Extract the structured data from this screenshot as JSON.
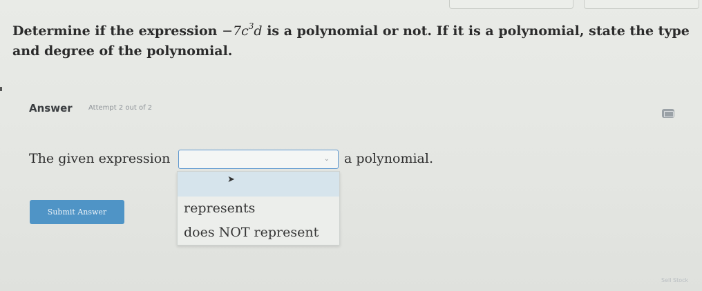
{
  "question": {
    "text_before": "Determine if the expression ",
    "expr_sign": "−",
    "expr_coef": "7",
    "expr_var1": "c",
    "expr_exp": "3",
    "expr_var2": "d",
    "text_after": " is a polynomial or not. If it is a polynomial, state the type and degree of the polynomial."
  },
  "answer": {
    "label": "Answer",
    "attempt": "Attempt 2 out of 2"
  },
  "sentence": {
    "before": "The given expression",
    "after": "a polynomial."
  },
  "select": {
    "value": "",
    "options": [
      "",
      "represents",
      "does NOT represent"
    ]
  },
  "submit_label": "Submit Answer",
  "corner_text": "Sell Stock",
  "icons": {
    "keyboard": "keyboard-icon",
    "chevron": "chevron-down-icon",
    "cursor": "mouse-cursor-icon"
  },
  "colors": {
    "accent_blue": "#4f94c6",
    "select_border": "#5c97cf",
    "highlight": "#d6e4ec"
  }
}
